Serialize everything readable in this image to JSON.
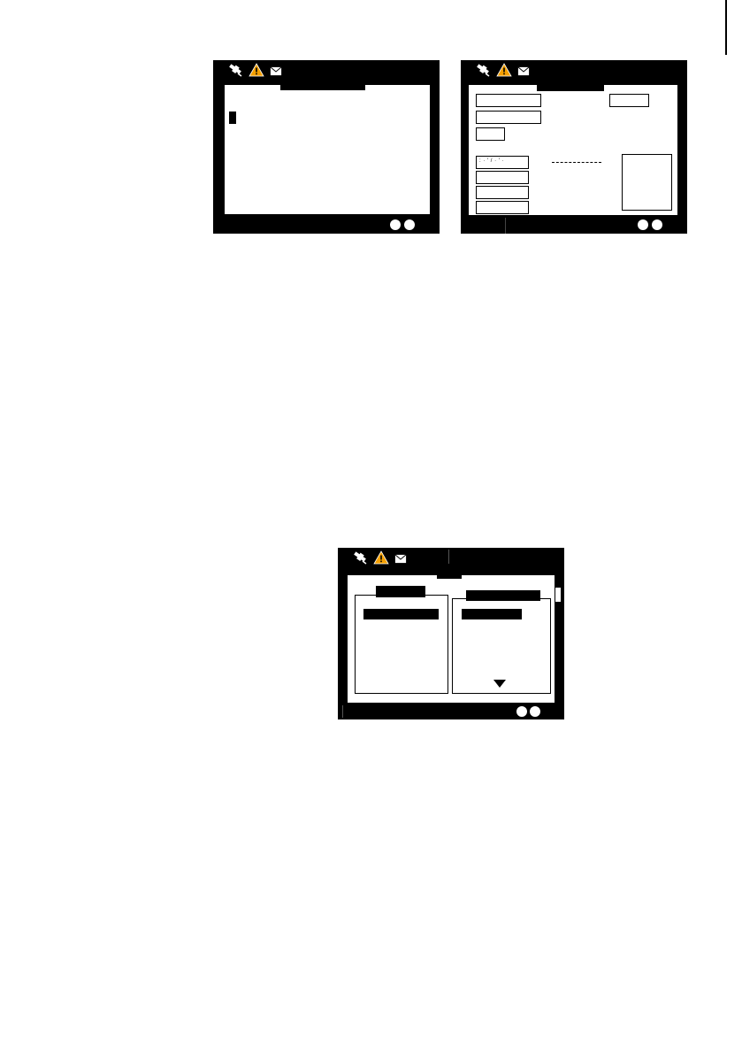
{
  "screens": [
    {
      "name": "text-entry-screen",
      "status_icons": [
        "gps-icon",
        "warning-icon",
        "message-icon"
      ],
      "indicators": [
        "indicator-dot",
        "indicator-dot"
      ]
    },
    {
      "name": "form-screen",
      "status_icons": [
        "gps-icon",
        "warning-icon",
        "message-icon"
      ],
      "field_label": ": · ′ / · ′ ·",
      "indicators": [
        "indicator-dot",
        "indicator-dot"
      ]
    },
    {
      "name": "dual-list-screen",
      "status_icons": [
        "gps-icon",
        "warning-icon",
        "message-icon"
      ],
      "indicators": [
        "indicator-dot",
        "indicator-dot"
      ]
    }
  ],
  "colors": {
    "screen_bg": "#000000",
    "panel_bg": "#ffffff",
    "warning": "#f5a000"
  }
}
